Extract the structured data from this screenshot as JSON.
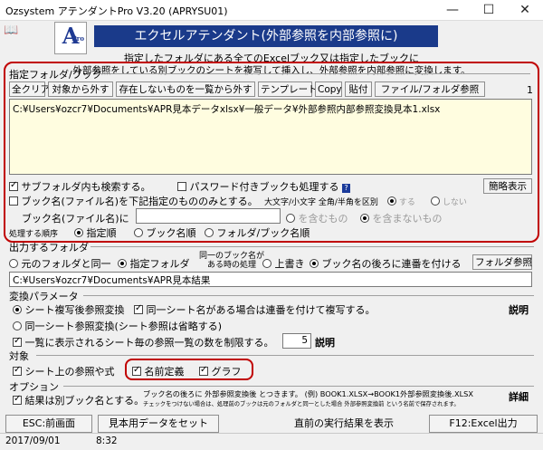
{
  "window": {
    "title": "Ozsystem アテンダントPro V3.20 (APRYSU01)",
    "minimize": "—",
    "maximize": "☐",
    "close": "✕"
  },
  "header": {
    "book_icon": "book-icon",
    "logo_letter": "A",
    "logo_sub": "Pro",
    "banner": "エクセルアテンダント(外部参照を内部参照に)",
    "desc_line1": "指定したフォルダにある全てのExcelブック又は指定したブックに",
    "desc_line2": "外部参照をしている別ブックのシートを複写して挿入し、外部参照を内部参照に変換します。"
  },
  "target": {
    "section_label": "指定フォルダ/ブック",
    "buttons": {
      "clear_all": "全クリア",
      "remove": "対象から外す",
      "remove_missing": "存在しないものを一覧から外す",
      "template": "テンプレート",
      "copy": "Copy",
      "paste": "貼付",
      "browse": "ファイル/フォルダ参照"
    },
    "count": "1",
    "path": "C:¥Users¥ozcr7¥Documents¥APR見本データxlsx¥一般データ¥外部参照内部参照変換見本1.xlsx",
    "subfolder_label": "サブフォルダ内も検索する。",
    "password_label": "パスワード付きブックも処理する",
    "help_mark": "?",
    "simple_view": "簡略表示",
    "name_filter_label": "ブック名(ファイル名)を下記指定のもののみとする。",
    "case_label": "大文字/小文字 全角/半角を区別",
    "case_yes": "する",
    "case_no": "しない",
    "book_name_in": "ブック名(ファイル名)に",
    "contains": "を含むもの",
    "not_contains": "を含まないもの",
    "order_label": "処理する順序",
    "order_specified": "指定順",
    "order_book": "ブック名順",
    "order_folder_book": "フォルダ/ブック名順"
  },
  "output": {
    "section_label": "出力するフォルダ",
    "same_folder": "元のフォルダと同一",
    "specified_folder": "指定フォルダ",
    "same_name_line1": "同一のブック名が",
    "same_name_line2": "ある時の処理",
    "overwrite": "上書き",
    "append_seq": "ブック名の後ろに連番を付ける",
    "browse": "フォルダ参照",
    "path": "C:¥Users¥ozcr7¥Documents¥APR見本結果"
  },
  "params": {
    "section_label": "変換パラメータ",
    "copy_convert": "シート複写後参照変換",
    "same_sheet_seq": "同一シート名がある場合は連番を付けて複写する。",
    "same_sheet_convert": "同一シート参照変換(シート参照は省略する)",
    "limit_label": "一覧に表示されるシート毎の参照一覧の数を制限する。",
    "limit_value": "5",
    "explain": "説明",
    "explain_right": "説明"
  },
  "scope": {
    "section_label": "対象",
    "sheet_refs": "シート上の参照や式",
    "named": "名前定義",
    "graph": "グラフ"
  },
  "options": {
    "section_label": "オプション",
    "separate_book": "結果は別ブック名とする。",
    "note_line1": "ブック名の後ろに 外部参照変換後 とつきます。 (例) BOOK1.XLSX→BOOK1外部参照変換後.XLSX",
    "note_line2": "チェックをつけない場合は、処理前のブックは元のフォルダと同一とした場合 外部参照変換前 という名前で保存されます。",
    "detail": "詳細"
  },
  "footer": {
    "esc": "ESC:前画面",
    "sample": "見本用データをセット",
    "last_result": "直前の実行結果を表示",
    "f12": "F12:Excel出力"
  },
  "status": {
    "date": "2017/09/01",
    "time": "8:32"
  }
}
